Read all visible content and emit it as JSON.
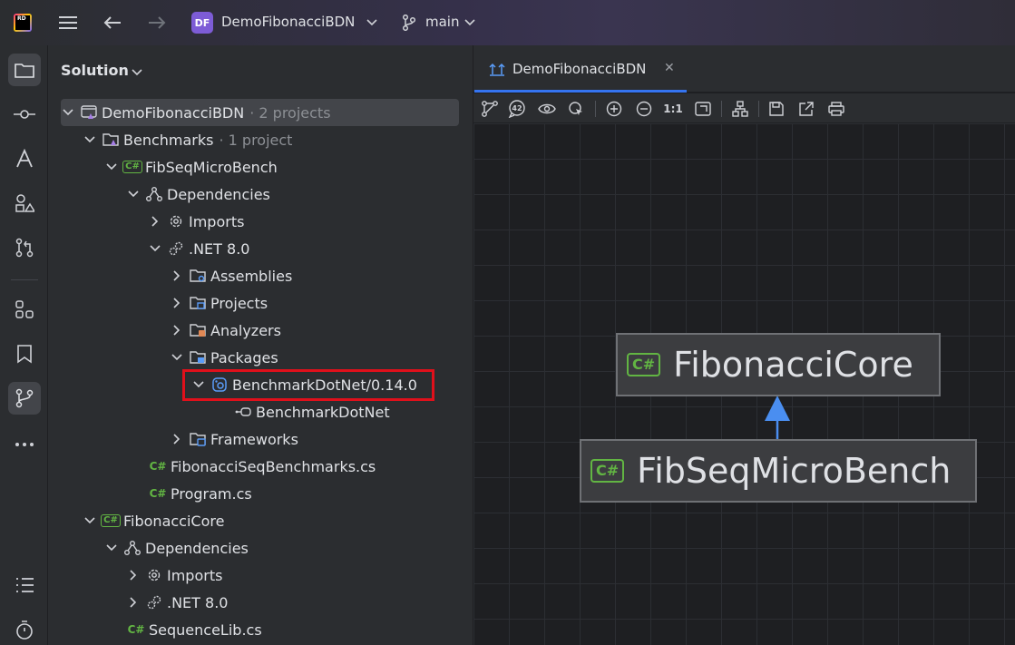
{
  "titlebar": {
    "logo_text": "RD",
    "project_badge": "DF",
    "project_name": "DemoFibonacciBDN",
    "branch": "main"
  },
  "solution": {
    "header": "Solution",
    "tree": [
      {
        "label": "DemoFibonacciBDN",
        "sub": "· 2 projects"
      },
      {
        "label": "Benchmarks",
        "sub": "· 1 project"
      },
      {
        "label": "FibSeqMicroBench"
      },
      {
        "label": "Dependencies"
      },
      {
        "label": "Imports"
      },
      {
        "label": ".NET 8.0"
      },
      {
        "label": "Assemblies"
      },
      {
        "label": "Projects"
      },
      {
        "label": "Analyzers"
      },
      {
        "label": "Packages"
      },
      {
        "label": "BenchmarkDotNet/0.14.0"
      },
      {
        "label": "BenchmarkDotNet"
      },
      {
        "label": "Frameworks"
      },
      {
        "label": "FibonacciSeqBenchmarks.cs"
      },
      {
        "label": "Program.cs"
      },
      {
        "label": "FibonacciCore"
      },
      {
        "label": "Dependencies"
      },
      {
        "label": "Imports"
      },
      {
        "label": ".NET 8.0"
      },
      {
        "label": "SequenceLib.cs"
      }
    ]
  },
  "editor": {
    "tab_label": "DemoFibonacciBDN",
    "zoom_actual": "1:1",
    "badge_42": "42"
  },
  "diagram": {
    "cs_badge": "C#",
    "nodes": [
      {
        "label": "FibonacciCore"
      },
      {
        "label": "FibSeqMicroBench"
      }
    ]
  }
}
